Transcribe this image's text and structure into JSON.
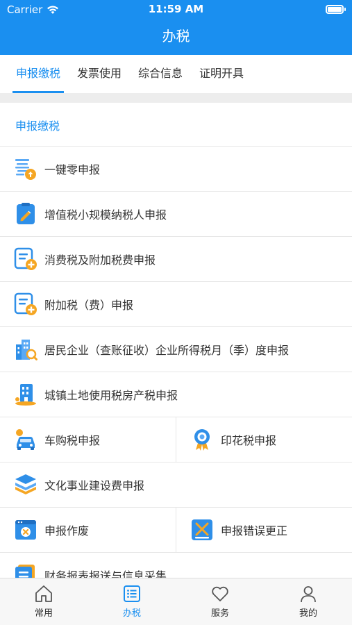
{
  "status": {
    "carrier": "Carrier",
    "time": "11:59 AM"
  },
  "nav": {
    "title": "办税"
  },
  "tabs": [
    {
      "label": "申报缴税"
    },
    {
      "label": "发票使用"
    },
    {
      "label": "综合信息"
    },
    {
      "label": "证明开具"
    }
  ],
  "section": {
    "title": "申报缴税"
  },
  "items": {
    "zero_declare": "一键零申报",
    "vat_small": "增值税小规模纳税人申报",
    "consumption_tax": "消费税及附加税费申报",
    "surcharge": "附加税（费）申报",
    "enterprise_income": "居民企业（查账征收）企业所得税月（季）度申报",
    "land_property": "城镇土地使用税房产税申报",
    "vehicle_purchase": "车购税申报",
    "stamp_duty": "印花税申报",
    "culture_fee": "文化事业建设费申报",
    "void_declare": "申报作废",
    "correct_error": "申报错误更正",
    "financial_report": "财务报表报送与信息采集"
  },
  "tabbar": [
    {
      "label": "常用",
      "icon": "home-icon"
    },
    {
      "label": "办税",
      "icon": "list-icon"
    },
    {
      "label": "服务",
      "icon": "heart-icon"
    },
    {
      "label": "我的",
      "icon": "user-icon"
    }
  ],
  "colors": {
    "primary": "#1a8ff0",
    "orange": "#f5a623"
  }
}
